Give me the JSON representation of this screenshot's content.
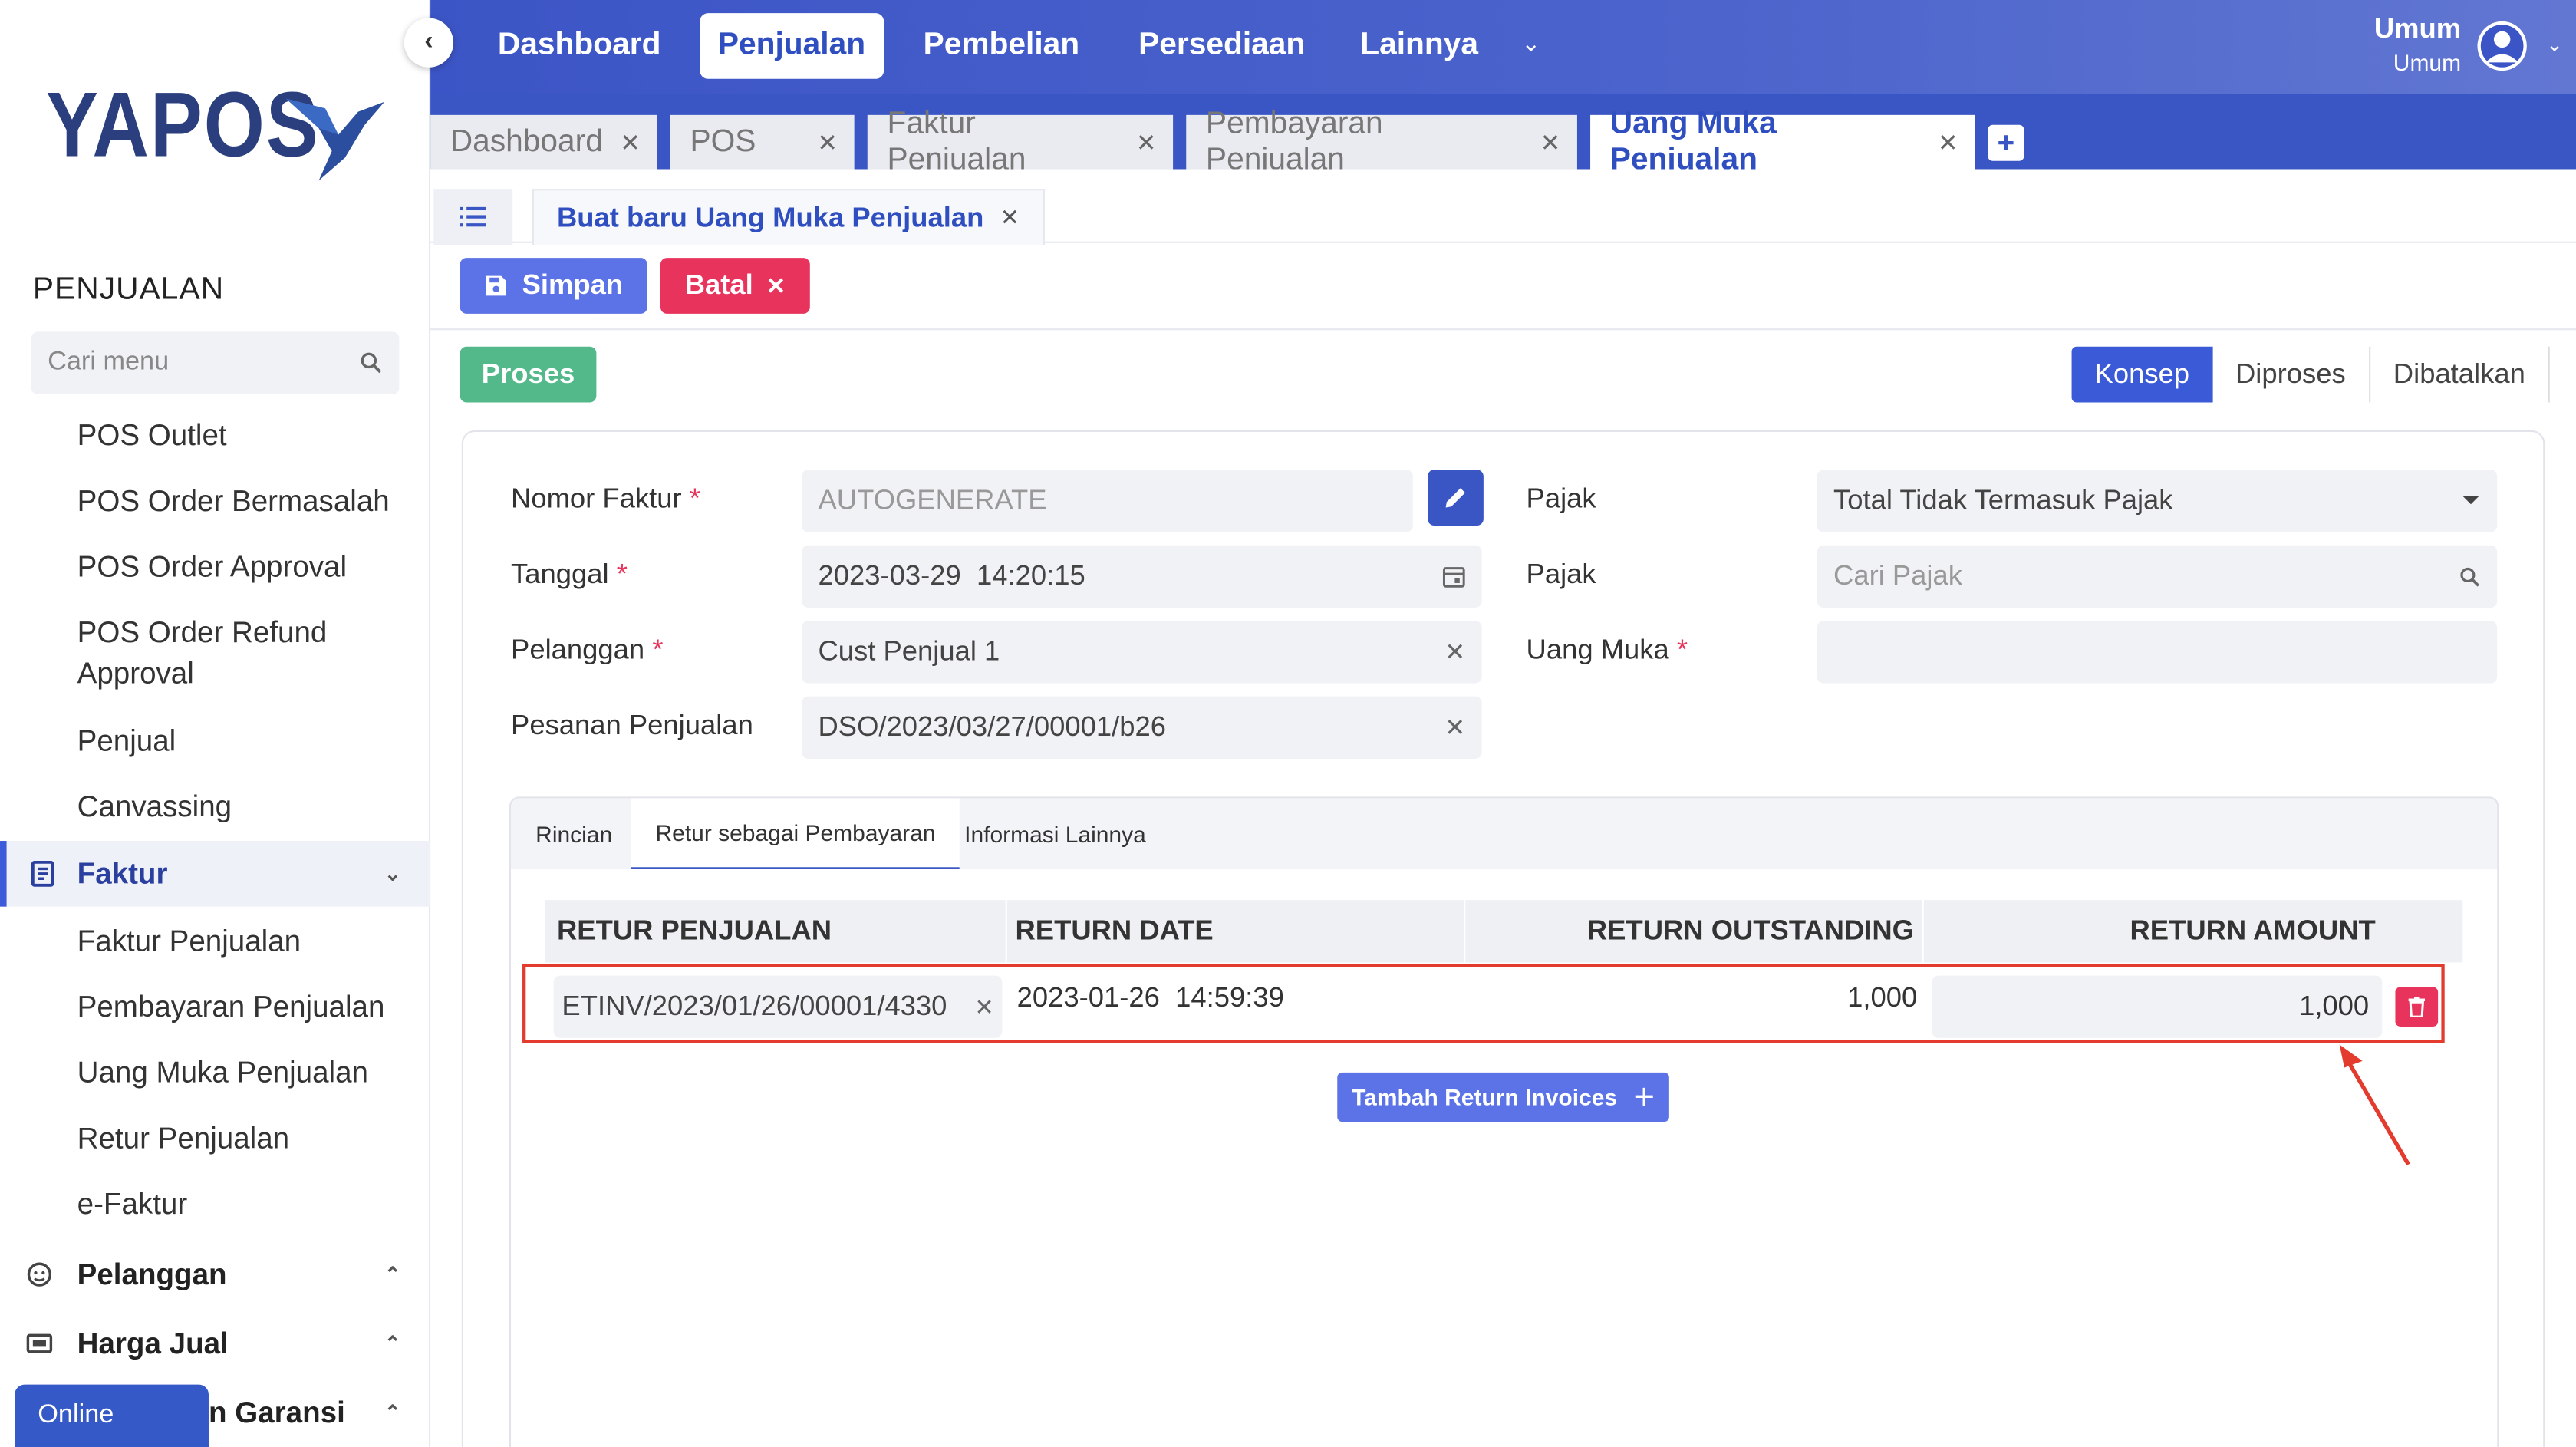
{
  "brand": {
    "logo_text": "YAPOS"
  },
  "sidebar": {
    "section_title": "PENJUALAN",
    "search_placeholder": "Cari menu",
    "items": [
      {
        "label": "POS Outlet"
      },
      {
        "label": "POS Order Bermasalah"
      },
      {
        "label": "POS Order Approval"
      },
      {
        "label": "POS Order Refund Approval"
      },
      {
        "label": "Penjual"
      },
      {
        "label": "Canvassing"
      }
    ],
    "faktur_group": {
      "label": "Faktur",
      "expanded": true
    },
    "faktur_items": [
      {
        "label": "Faktur Penjualan"
      },
      {
        "label": "Pembayaran Penjualan"
      },
      {
        "label": "Uang Muka Penjualan"
      },
      {
        "label": "Retur Penjualan"
      },
      {
        "label": "e-Faktur"
      }
    ],
    "groups": [
      {
        "label": "Pelanggan"
      },
      {
        "label": "Harga Jual"
      },
      {
        "label": "n Garansi"
      }
    ],
    "online_badge": "Online"
  },
  "topnav": {
    "items": [
      {
        "label": "Dashboard"
      },
      {
        "label": "Penjualan",
        "active": true
      },
      {
        "label": "Pembelian"
      },
      {
        "label": "Persediaan"
      },
      {
        "label": "Lainnya"
      }
    ],
    "user": {
      "name": "Umum",
      "role": "Umum"
    }
  },
  "tabs": [
    {
      "label": "Dashboard"
    },
    {
      "label": "POS"
    },
    {
      "label": "Faktur Penjualan"
    },
    {
      "label": "Pembayaran Penjualan"
    },
    {
      "label": "Uang Muka Penjualan",
      "active": true
    }
  ],
  "subtab": {
    "label": "Buat baru Uang Muka Penjualan"
  },
  "actions": {
    "save": "Simpan",
    "cancel": "Batal",
    "process": "Proses"
  },
  "status_steps": [
    "Konsep",
    "Diproses",
    "Dibatalkan"
  ],
  "form": {
    "nomor_faktur": {
      "label": "Nomor Faktur",
      "placeholder": "AUTOGENERATE"
    },
    "tanggal": {
      "label": "Tanggal",
      "value": "2023-03-29  14:20:15"
    },
    "pelanggan": {
      "label": "Pelanggan",
      "value": "Cust Penjual 1"
    },
    "pesanan": {
      "label": "Pesanan Penjualan",
      "value": "DSO/2023/03/27/00001/b26"
    },
    "pajak_type": {
      "label": "Pajak",
      "value": "Total Tidak Termasuk Pajak"
    },
    "pajak_search": {
      "label": "Pajak",
      "placeholder": "Cari Pajak"
    },
    "uang_muka": {
      "label": "Uang Muka",
      "value": ""
    },
    "required_mark": "*"
  },
  "inner_tabs": [
    {
      "label": "Rincian"
    },
    {
      "label": "Retur sebagai Pembayaran",
      "active": true
    },
    {
      "label": "Informasi Lainnya"
    }
  ],
  "return_table": {
    "headers": [
      "RETUR PENJUALAN",
      "RETURN DATE",
      "RETURN OUTSTANDING",
      "RETURN AMOUNT"
    ],
    "rows": [
      {
        "retur": "ETINV/2023/01/26/00001/4330",
        "date": "2023-01-26  14:59:39",
        "outstanding": "1,000",
        "amount": "1,000"
      }
    ],
    "add_button": "Tambah Return Invoices"
  },
  "colors": {
    "primary": "#3a55c4",
    "danger": "#e8345c",
    "success": "#54b98a",
    "highlight": "#e33b2e"
  }
}
